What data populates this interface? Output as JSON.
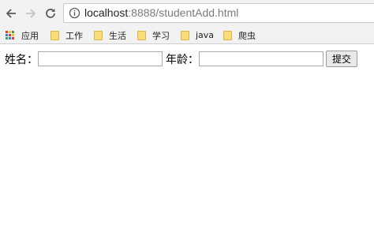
{
  "browser": {
    "url_host": "localhost",
    "url_rest": ":8888/studentAdd.html"
  },
  "bookmarks": [
    {
      "label": "应用",
      "icon": "apps-grid-icon"
    },
    {
      "label": "工作",
      "icon": "folder-icon"
    },
    {
      "label": "生活",
      "icon": "folder-icon"
    },
    {
      "label": "学习",
      "icon": "folder-icon"
    },
    {
      "label": "java",
      "icon": "folder-icon"
    },
    {
      "label": "爬虫",
      "icon": "folder-icon"
    }
  ],
  "form": {
    "name_label": "姓名：",
    "name_value": "",
    "age_label": "年龄：",
    "age_value": "",
    "submit_label": "提交"
  },
  "colors": {
    "chrome_bg": "#f2f2f2",
    "folder": "#f8dd7a"
  }
}
